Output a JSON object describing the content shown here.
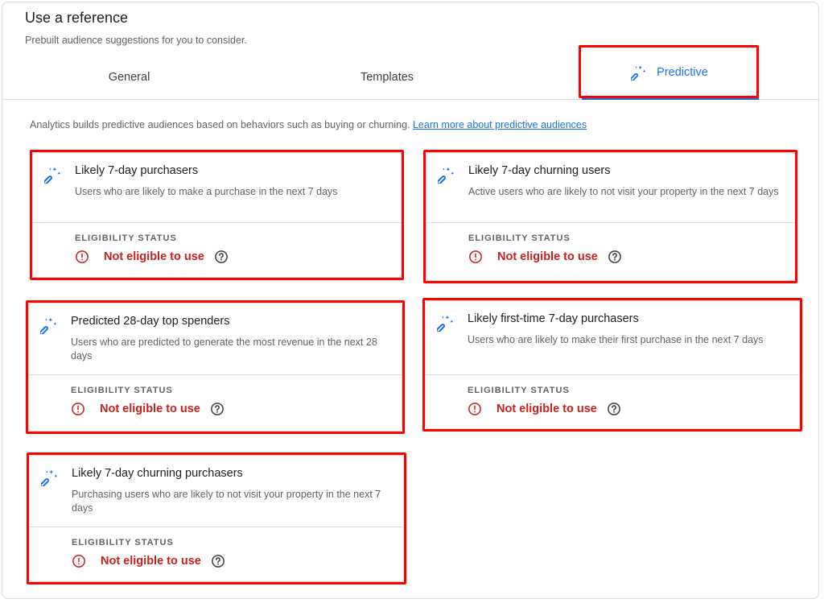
{
  "header": {
    "title": "Use a reference",
    "subtitle": "Prebuilt audience suggestions for you to consider."
  },
  "tabs": [
    {
      "label": "General",
      "selected": false
    },
    {
      "label": "Templates",
      "selected": false
    },
    {
      "label": "Predictive",
      "selected": true,
      "icon": "magic-wand-icon"
    }
  ],
  "intro": {
    "text": "Analytics builds predictive audiences based on behaviors such as buying or churning. ",
    "link": "Learn more about predictive audiences"
  },
  "cards": [
    {
      "title": "Likely 7-day purchasers",
      "description": "Users who are likely to make a purchase in the next 7 days",
      "eligibility_label": "ELIGIBILITY STATUS",
      "status": "Not eligible to use"
    },
    {
      "title": "Likely 7-day churning users",
      "description": "Active users who are likely to not visit your property in the next 7 days",
      "eligibility_label": "ELIGIBILITY STATUS",
      "status": "Not eligible to use"
    },
    {
      "title": "Predicted 28-day top spenders",
      "description": "Users who are predicted to generate the most revenue in the next 28 days",
      "eligibility_label": "ELIGIBILITY STATUS",
      "status": "Not eligible to use"
    },
    {
      "title": "Likely first-time 7-day purchasers",
      "description": "Users who are likely to make their first purchase in the next 7 days",
      "eligibility_label": "ELIGIBILITY STATUS",
      "status": "Not eligible to use"
    },
    {
      "title": "Likely 7-day churning purchasers",
      "description": "Purchasing users who are likely to not visit your property in the next 7 days",
      "eligibility_label": "ELIGIBILITY STATUS",
      "status": "Not eligible to use"
    }
  ],
  "colors": {
    "accent": "#1a73e8",
    "error": "#c5221f",
    "highlight": "#ff0000"
  }
}
